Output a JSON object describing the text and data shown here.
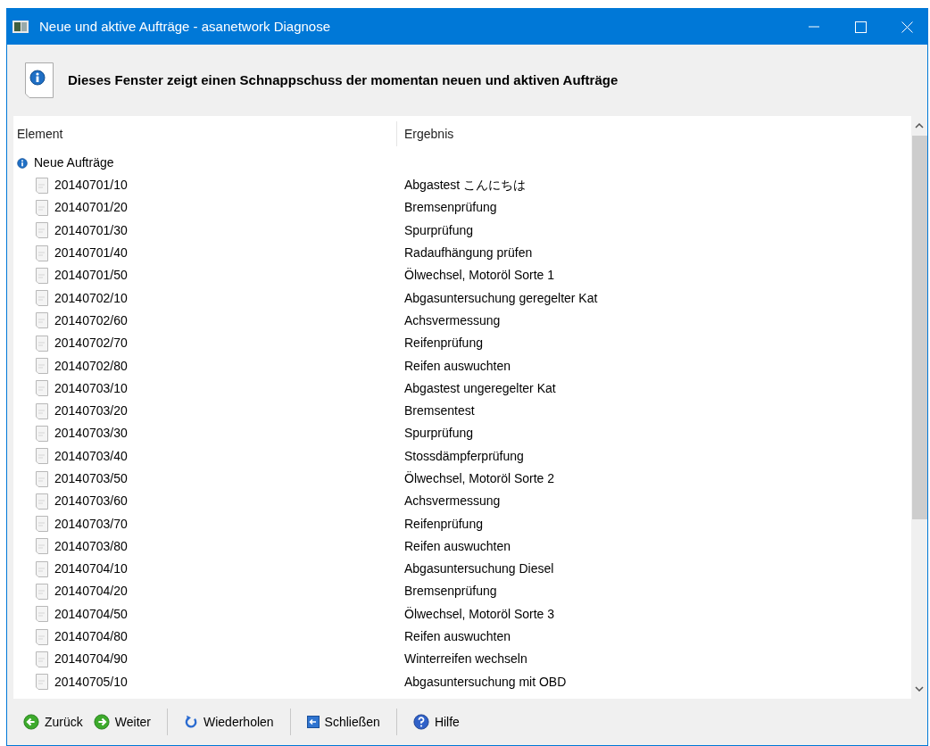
{
  "window": {
    "title": "Neue und aktive Aufträge - asanetwork Diagnose"
  },
  "header": {
    "text": "Dieses Fenster zeigt einen Schnappschuss der momentan neuen und aktiven Aufträge"
  },
  "table": {
    "columns": [
      "Element",
      "Ergebnis"
    ],
    "tree": [
      {
        "element": "Neue Aufträge",
        "children": [
          {
            "element": "20140701/10",
            "result": "Abgastest こんにちは"
          },
          {
            "element": "20140701/20",
            "result": "Bremsenprüfung"
          },
          {
            "element": "20140701/30",
            "result": "Spurprüfung"
          },
          {
            "element": "20140701/40",
            "result": "Radaufhängung prüfen"
          },
          {
            "element": "20140701/50",
            "result": "Ölwechsel, Motoröl Sorte 1"
          },
          {
            "element": "20140702/10",
            "result": "Abgasuntersuchung geregelter Kat"
          },
          {
            "element": "20140702/60",
            "result": "Achsvermessung"
          },
          {
            "element": "20140702/70",
            "result": "Reifenprüfung"
          },
          {
            "element": "20140702/80",
            "result": "Reifen auswuchten"
          },
          {
            "element": "20140703/10",
            "result": "Abgastest ungeregelter Kat"
          },
          {
            "element": "20140703/20",
            "result": "Bremsentest"
          },
          {
            "element": "20140703/30",
            "result": "Spurprüfung"
          },
          {
            "element": "20140703/40",
            "result": "Stossdämpferprüfung"
          },
          {
            "element": "20140703/50",
            "result": "Ölwechsel, Motoröl Sorte 2"
          },
          {
            "element": "20140703/60",
            "result": "Achsvermessung"
          },
          {
            "element": "20140703/70",
            "result": "Reifenprüfung"
          },
          {
            "element": "20140703/80",
            "result": "Reifen auswuchten"
          },
          {
            "element": "20140704/10",
            "result": "Abgasuntersuchung Diesel"
          },
          {
            "element": "20140704/20",
            "result": "Bremsenprüfung"
          },
          {
            "element": "20140704/50",
            "result": "Ölwechsel, Motoröl Sorte 3"
          },
          {
            "element": "20140704/80",
            "result": "Reifen auswuchten"
          },
          {
            "element": "20140704/90",
            "result": "Winterreifen wechseln"
          },
          {
            "element": "20140705/10",
            "result": "Abgasuntersuchung mit OBD"
          }
        ]
      }
    ]
  },
  "toolbar": [
    {
      "kind": "back",
      "label": "Zurück"
    },
    {
      "kind": "next",
      "label": "Weiter"
    },
    {
      "kind": "reload",
      "label": "Wiederholen"
    },
    {
      "kind": "close",
      "label": "Schließen"
    },
    {
      "kind": "help",
      "label": "Hilfe"
    }
  ]
}
